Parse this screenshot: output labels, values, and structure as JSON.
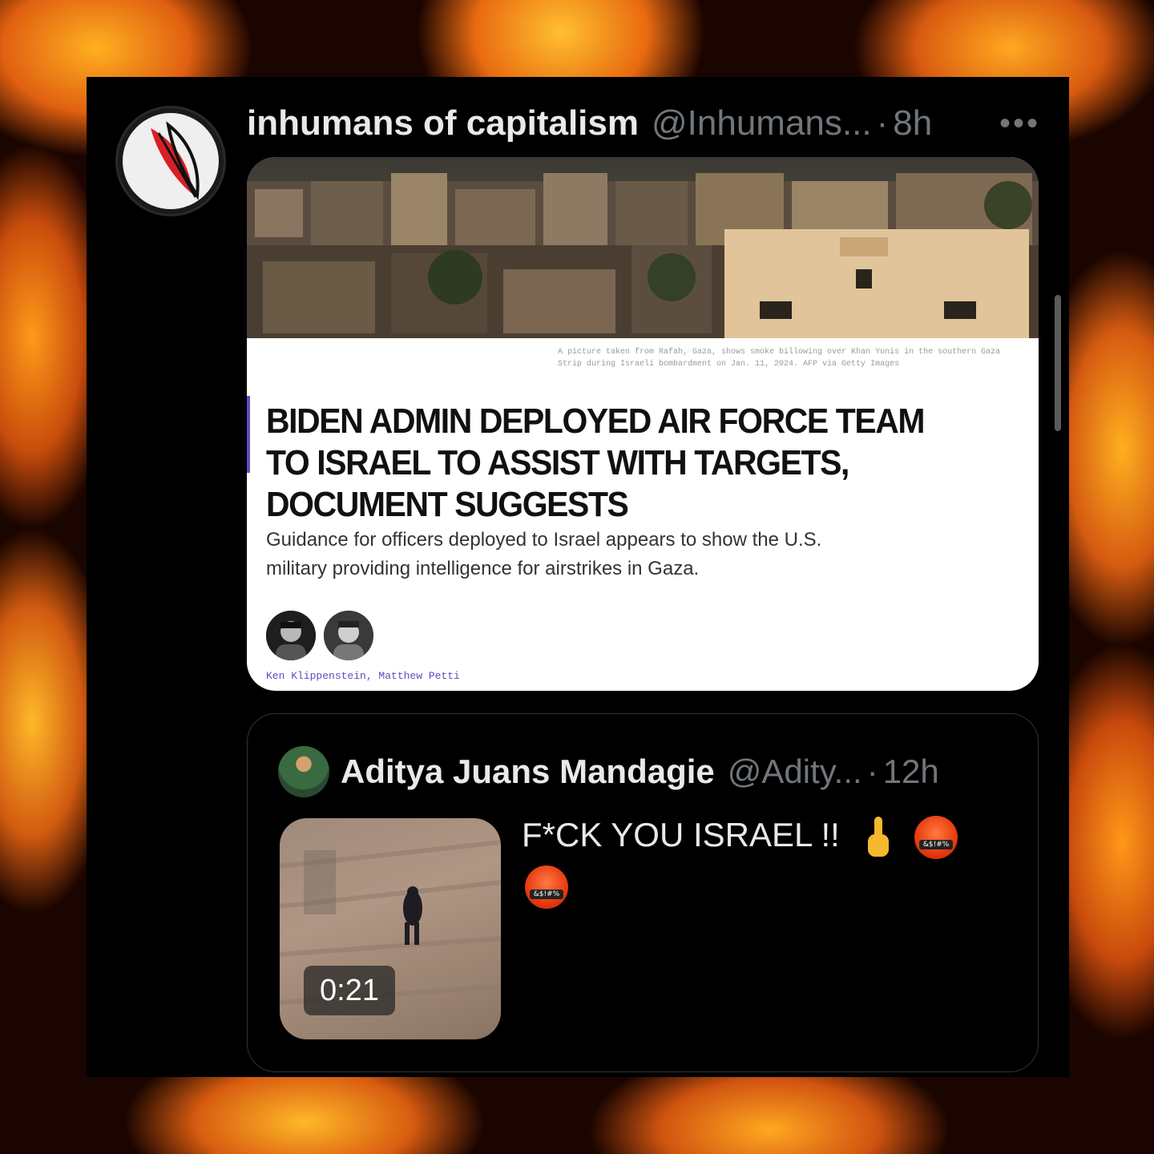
{
  "post": {
    "author_name": "inhumans of capitalism",
    "author_handle": "@Inhumans...",
    "separator": "·",
    "time": "8h",
    "more_label": "•••",
    "article": {
      "caption": "A picture taken from Rafah, Gaza, shows smoke billowing over Khan Yunis in the southern Gaza Strip during Israeli bombardment on Jan. 11, 2024. AFP via Getty Images",
      "headline": "BIDEN ADMIN DEPLOYED AIR FORCE TEAM TO ISRAEL TO ASSIST WITH TARGETS, DOCUMENT SUGGESTS",
      "dek": "Guidance for officers deployed to Israel appears to show the U.S. military providing intelligence for airstrikes in Gaza.",
      "byline": "Ken Klippenstein, Matthew Petti"
    }
  },
  "quoted_post": {
    "author_name": "Aditya Juans Mandagie",
    "author_handle": "@Adity...",
    "separator": "·",
    "time": "12h",
    "text": "F*CK YOU ISRAEL !!",
    "emoji_symbols": "&$!#%",
    "video_duration": "0:21"
  },
  "colors": {
    "accent": "#5e4cc2",
    "text_primary": "#e7e9ea",
    "text_secondary": "#71767b"
  }
}
